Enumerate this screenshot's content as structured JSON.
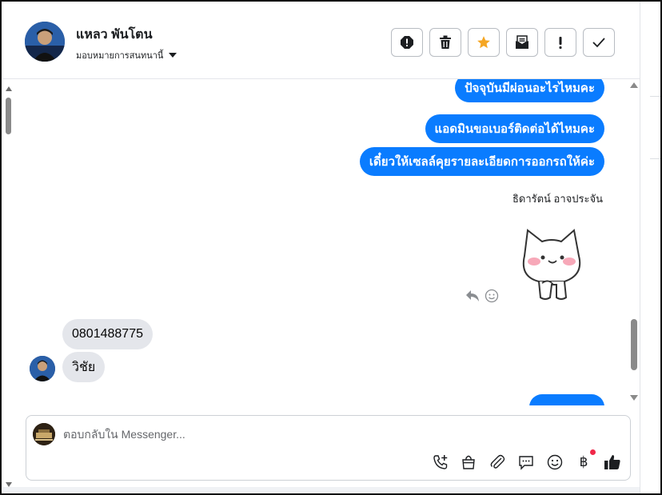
{
  "header": {
    "contact_name": "แหลว พันโตน",
    "assign_label": "มอบหมายการสนทนานี้"
  },
  "messages": {
    "outgoing": [
      "ปัจจุบันมีผ่อนอะไรไหมคะ",
      "แอดมินขอเบอร์ติดต่อได้ไหมคะ",
      "เดี๋ยวให้เซลล์คุยรายละเอียดการออกรถให้ค่ะ"
    ],
    "sender_label": "ธิดารัตน์ อาจประจัน",
    "incoming": [
      "0801488775",
      "วิชัย"
    ]
  },
  "composer": {
    "placeholder": "ตอบกลับใน Messenger..."
  },
  "colors": {
    "outgoing_bubble": "#0a7cff",
    "incoming_bubble": "#e4e6eb",
    "star": "#f5a623",
    "notification_dot": "#f02849"
  },
  "icons": {
    "header_actions": [
      "report-icon",
      "trash-icon",
      "star-icon",
      "mark-unread-icon",
      "important-icon",
      "done-icon"
    ],
    "composer_tools": [
      "call-add-icon",
      "shopping-bag-icon",
      "attachment-icon",
      "saved-reply-icon",
      "emoji-icon",
      "payment-baht-icon",
      "like-icon"
    ]
  }
}
